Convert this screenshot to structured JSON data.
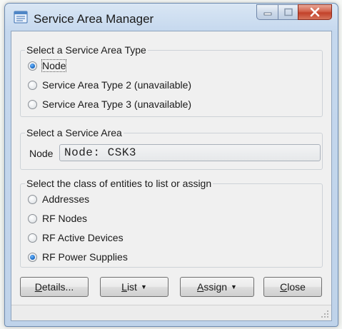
{
  "window": {
    "title": "Service Area Manager",
    "icon": "app-icon"
  },
  "caption_buttons": {
    "minimize_icon": "minimize-icon",
    "maximize_icon": "maximize-icon",
    "close_icon": "close-icon"
  },
  "service_area_type": {
    "legend": "Select a Service Area Type",
    "options": [
      {
        "label": "Node",
        "checked": true
      },
      {
        "label": "Service Area Type 2 (unavailable)",
        "checked": false
      },
      {
        "label": "Service Area Type 3 (unavailable)",
        "checked": false
      }
    ]
  },
  "service_area": {
    "legend": "Select a Service Area",
    "field_label": "Node",
    "field_value": "Node: CSK3"
  },
  "entity_class": {
    "legend": "Select the class of entities to list or assign",
    "options": [
      {
        "label": "Addresses",
        "checked": false
      },
      {
        "label": "RF Nodes",
        "checked": false
      },
      {
        "label": "RF Active Devices",
        "checked": false
      },
      {
        "label": "RF Power Supplies",
        "checked": true
      }
    ]
  },
  "buttons": {
    "details": {
      "underline": "D",
      "rest": "etails..."
    },
    "list": {
      "underline": "L",
      "rest": "ist",
      "arrow": "▼"
    },
    "assign": {
      "underline": "A",
      "rest": "ssign",
      "arrow": "▼"
    },
    "close": {
      "underline": "C",
      "rest": "lose"
    }
  },
  "colors": {
    "selected_radio": "#1f6fc8",
    "close_button": "#c2412a"
  }
}
